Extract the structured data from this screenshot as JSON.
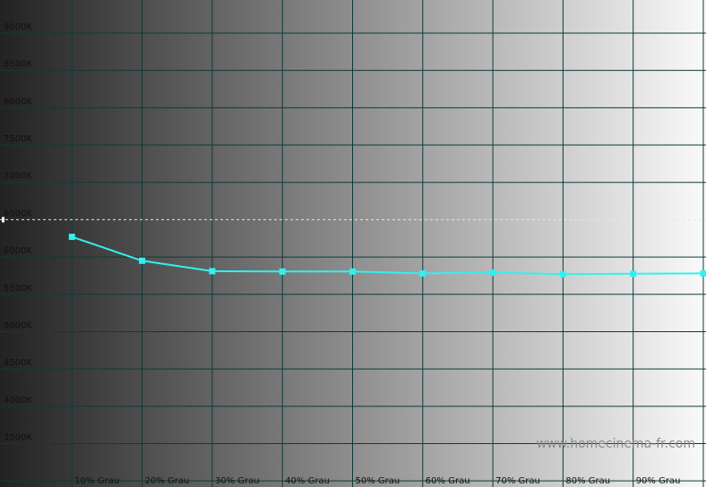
{
  "chart_data": {
    "type": "line",
    "title": "",
    "xlabel": "",
    "ylabel": "",
    "y_tick_labels": [
      "3500K",
      "4000K",
      "4500K",
      "5000K",
      "5500K",
      "6000K",
      "6500K",
      "7000K",
      "7500K",
      "8000K",
      "8500K",
      "9000K"
    ],
    "y_ticks": [
      3500,
      4000,
      4500,
      5000,
      5500,
      6000,
      6500,
      7000,
      7500,
      8000,
      8500,
      9000
    ],
    "ylim": [
      3000,
      9400
    ],
    "x_tick_labels": [
      "10% Grau",
      "20% Grau",
      "30% Grau",
      "40% Grau",
      "50% Grau",
      "60% Grau",
      "70% Grau",
      "80% Grau",
      "90% Grau"
    ],
    "x": [
      10,
      20,
      30,
      40,
      50,
      60,
      70,
      80,
      90,
      100
    ],
    "xlim": [
      0,
      100
    ],
    "reference_line": 6500,
    "grid": true,
    "series": [
      {
        "values": [
          6270,
          5950,
          5810,
          5805,
          5805,
          5780,
          5790,
          5770,
          5775,
          5780
        ]
      }
    ],
    "colors": {
      "series": "#33f0f0",
      "grid": "#0f3a3a",
      "reference": "#e6e6e6",
      "background_start": "#222222",
      "background_end": "#fafafa"
    },
    "watermark": "www.homecinema-fr.com"
  }
}
